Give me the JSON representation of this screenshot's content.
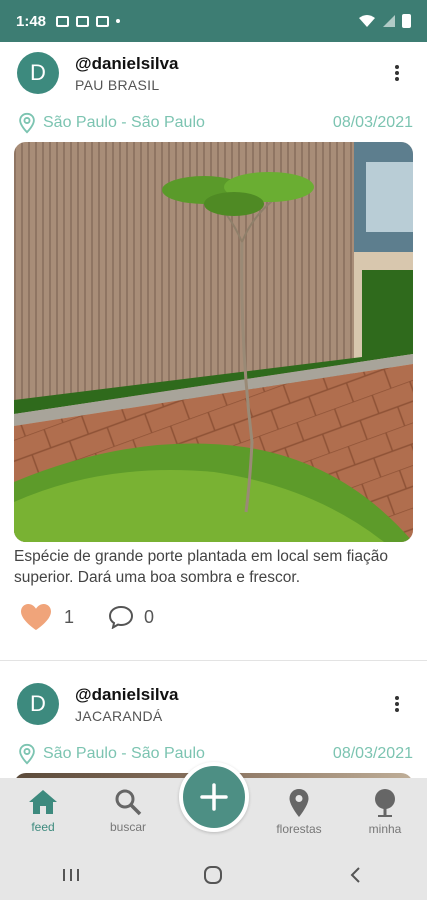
{
  "status_bar": {
    "time": "1:48"
  },
  "posts": [
    {
      "avatar_letter": "D",
      "username": "@danielsilva",
      "species": "PAU BRASIL",
      "location": "São Paulo -  São Paulo",
      "date": "08/03/2021",
      "caption": "Espécie de grande porte  plantada em local sem fiação superior. Dará uma boa sombra e frescor.",
      "likes": "1",
      "comments": "0"
    },
    {
      "avatar_letter": "D",
      "username": "@danielsilva",
      "species": "JACARANDÁ",
      "location": "São Paulo -  São Paulo",
      "date": "08/03/2021"
    }
  ],
  "bottom_nav": {
    "items": [
      {
        "label": "feed",
        "icon": "home-icon",
        "active": true
      },
      {
        "label": "buscar",
        "icon": "search-icon"
      },
      {
        "label": "florestas",
        "icon": "map-pin-icon"
      },
      {
        "label": "minha",
        "icon": "tree-icon"
      }
    ],
    "fab_icon": "plus-icon"
  },
  "colors": {
    "primary": "#3d8a7e",
    "status_bar": "#3d7d73",
    "accent_text": "#7cc4b1",
    "like": "#f0a47a",
    "nav_bg": "#e6e6e6"
  }
}
